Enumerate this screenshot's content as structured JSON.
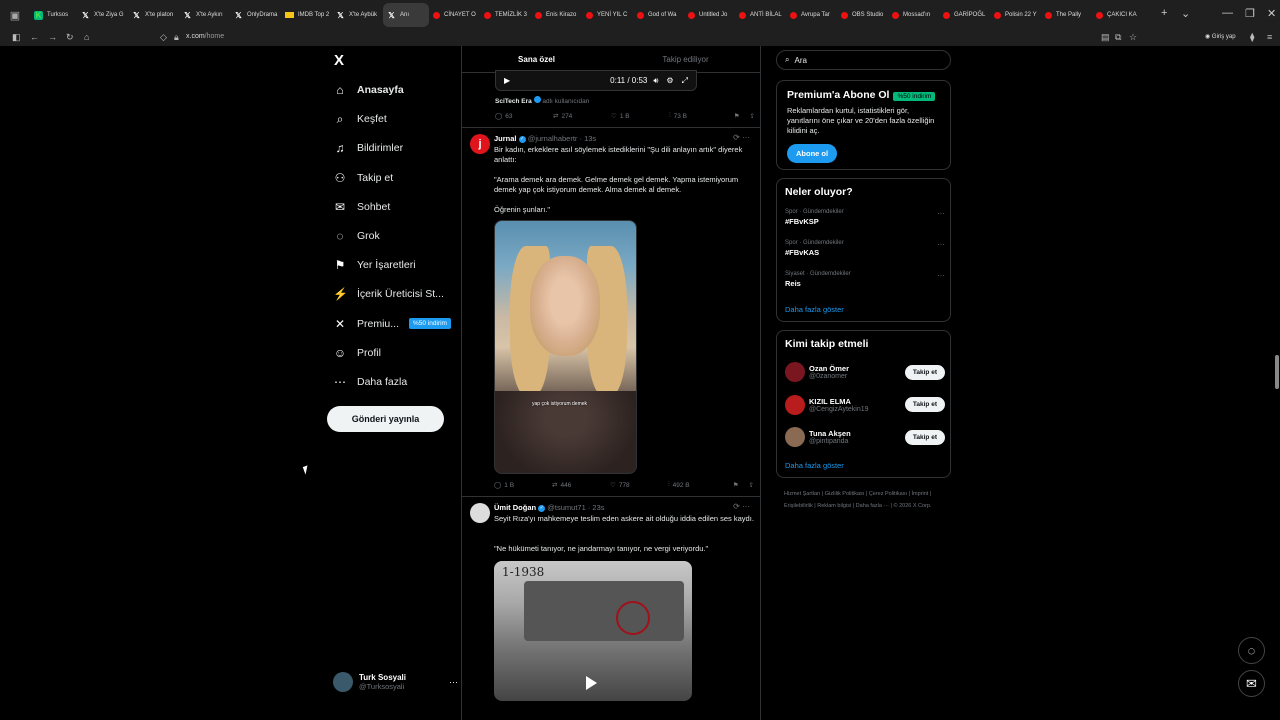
{
  "browser": {
    "tabs": [
      {
        "label": "Turksos",
        "fav": "green"
      },
      {
        "label": "X'te Ziya G",
        "fav": "x"
      },
      {
        "label": "X'te platon",
        "fav": "x"
      },
      {
        "label": "X'te Aykırı",
        "fav": "x"
      },
      {
        "label": "OnlyDrama",
        "fav": "x"
      },
      {
        "label": "IMDB Top 2",
        "fav": "mdb"
      },
      {
        "label": "X'te Aybük",
        "fav": "x"
      },
      {
        "label": "Anı",
        "fav": "x",
        "active": true
      },
      {
        "label": "CİNAYET O",
        "fav": "red"
      },
      {
        "label": "TEMİZLİK 3",
        "fav": "red"
      },
      {
        "label": "Enis Kirazo",
        "fav": "red"
      },
      {
        "label": "YENİ YIL C",
        "fav": "red"
      },
      {
        "label": "God of Wa",
        "fav": "red"
      },
      {
        "label": "Untitled Jo",
        "fav": "red"
      },
      {
        "label": "ANTİ BİLAL",
        "fav": "red"
      },
      {
        "label": "Avrupa Tar",
        "fav": "red"
      },
      {
        "label": "OBS Studio",
        "fav": "red"
      },
      {
        "label": "Mossad'ın",
        "fav": "red"
      },
      {
        "label": "GARİPOĞL",
        "fav": "red"
      },
      {
        "label": "Polisin 22 Y",
        "fav": "red"
      },
      {
        "label": "The Pally",
        "fav": "red"
      },
      {
        "label": "ÇAKICI KA",
        "fav": "red"
      }
    ],
    "url_host": "x.com",
    "url_path": "/home",
    "login_label": "Giriş yap"
  },
  "sidebar": {
    "logo": "X",
    "items": [
      {
        "label": "Anasayfa",
        "icon": "home-icon",
        "glyph": "⌂"
      },
      {
        "label": "Keşfet",
        "icon": "search-icon",
        "glyph": "⌕"
      },
      {
        "label": "Bildirimler",
        "icon": "bell-icon",
        "glyph": "♫"
      },
      {
        "label": "Takip et",
        "icon": "follow-icon",
        "glyph": "⚇"
      },
      {
        "label": "Sohbet",
        "icon": "mail-icon",
        "glyph": "✉"
      },
      {
        "label": "Grok",
        "icon": "grok-icon",
        "glyph": "◌"
      },
      {
        "label": "Yer İşaretleri",
        "icon": "bookmark-icon",
        "glyph": "⚑"
      },
      {
        "label": "İçerik Üreticisi St...",
        "icon": "creator-icon",
        "glyph": "⚡"
      },
      {
        "label": "Premiu...",
        "icon": "x-premium-icon",
        "glyph": "✕"
      },
      {
        "label": "Profil",
        "icon": "profile-icon",
        "glyph": "☺"
      },
      {
        "label": "Daha fazla",
        "icon": "more-icon",
        "glyph": "⋯"
      }
    ],
    "premium_badge": "%50 indirim",
    "post_button": "Gönderi yayınla",
    "account": {
      "name": "Turk Sosyali",
      "handle": "@Turksosyali"
    }
  },
  "feed": {
    "tabs": [
      "Sana özel",
      "Takip ediliyor"
    ],
    "video1": {
      "time": "0:11 / 0:53"
    },
    "video1_source": {
      "name": "SciTech Era",
      "suffix": "adlı kullanıcıdan"
    },
    "post0_actions": {
      "replies": "63",
      "reposts": "274",
      "likes": "1 B",
      "views": "73 B"
    },
    "post1": {
      "name": "Jurnal",
      "handle": "@jurnalhabertr · 13s",
      "text1": "Bir kadın, erkeklere asıl söylemek istediklerini \"Şu dili anlayın artık\" diyerek anlattı:",
      "text2": "\"Arama demek ara demek. Gelme demek gel demek. Yapma istemiyorum demek yap çok istiyorum demek. Alma demek al demek.",
      "text3": "Öğrenin şunları.\"",
      "caption": "yap çok istiyorum demek",
      "replies": "1 B",
      "reposts": "446",
      "likes": "778",
      "views": "492 B"
    },
    "post2": {
      "name": "Ümit Doğan",
      "handle": "@tsumut71 · 23s",
      "text1": "Seyit Rıza'yı mahkemeye teslim eden askere ait olduğu iddia edilen ses kaydı.",
      "text2": "\"Ne hükümeti tanıyor, ne jandarmayı tanıyor, ne vergi veriyordu.\"",
      "photo_year": "1-1938"
    }
  },
  "right": {
    "search_placeholder": "Ara",
    "premium": {
      "title": "Premium'a Abone Ol",
      "badge": "%50 indirim",
      "text": "Reklamlardan kurtul, istatistikleri gör, yanıtlarını öne çıkar ve 20'den fazla özelliğin kilidini aç.",
      "button": "Abone ol"
    },
    "trends": {
      "title": "Neler oluyor?",
      "items": [
        {
          "context": "Spor · Gündemdekiler",
          "topic": "#FBvKSP"
        },
        {
          "context": "Spor · Gündemdekiler",
          "topic": "#FBvKAS"
        },
        {
          "context": "Siyaset · Gündemdekiler",
          "topic": "Reis"
        }
      ],
      "more": "Daha fazla göster"
    },
    "who_to_follow": {
      "title": "Kimi takip etmeli",
      "items": [
        {
          "name": "Ozan Ömer",
          "handle": "@0zanomer",
          "color": "#7a1620"
        },
        {
          "name": "KIZIL ELMA",
          "handle": "@CengizAytekin19",
          "color": "#b81c1c"
        },
        {
          "name": "Tuna Akşen",
          "handle": "@pintipanda",
          "color": "#8a6a52"
        }
      ],
      "button": "Takip et",
      "more": "Daha fazla göster"
    },
    "footer": [
      "Hizmet Şartları",
      "Gizlilik Politikası",
      "Çerez Politikası",
      "İmprint",
      "Erişilebilirlik",
      "Reklam bilgisi",
      "Daha fazla ···",
      "© 2026 X Corp."
    ]
  }
}
